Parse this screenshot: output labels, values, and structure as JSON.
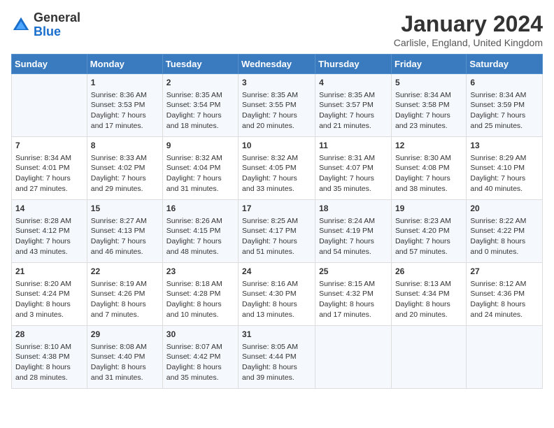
{
  "header": {
    "logo_line1": "General",
    "logo_line2": "Blue",
    "month": "January 2024",
    "location": "Carlisle, England, United Kingdom"
  },
  "days_of_week": [
    "Sunday",
    "Monday",
    "Tuesday",
    "Wednesday",
    "Thursday",
    "Friday",
    "Saturday"
  ],
  "weeks": [
    [
      {
        "day": "",
        "sunrise": "",
        "sunset": "",
        "daylight": ""
      },
      {
        "day": "1",
        "sunrise": "Sunrise: 8:36 AM",
        "sunset": "Sunset: 3:53 PM",
        "daylight": "Daylight: 7 hours and 17 minutes."
      },
      {
        "day": "2",
        "sunrise": "Sunrise: 8:35 AM",
        "sunset": "Sunset: 3:54 PM",
        "daylight": "Daylight: 7 hours and 18 minutes."
      },
      {
        "day": "3",
        "sunrise": "Sunrise: 8:35 AM",
        "sunset": "Sunset: 3:55 PM",
        "daylight": "Daylight: 7 hours and 20 minutes."
      },
      {
        "day": "4",
        "sunrise": "Sunrise: 8:35 AM",
        "sunset": "Sunset: 3:57 PM",
        "daylight": "Daylight: 7 hours and 21 minutes."
      },
      {
        "day": "5",
        "sunrise": "Sunrise: 8:34 AM",
        "sunset": "Sunset: 3:58 PM",
        "daylight": "Daylight: 7 hours and 23 minutes."
      },
      {
        "day": "6",
        "sunrise": "Sunrise: 8:34 AM",
        "sunset": "Sunset: 3:59 PM",
        "daylight": "Daylight: 7 hours and 25 minutes."
      }
    ],
    [
      {
        "day": "7",
        "sunrise": "Sunrise: 8:34 AM",
        "sunset": "Sunset: 4:01 PM",
        "daylight": "Daylight: 7 hours and 27 minutes."
      },
      {
        "day": "8",
        "sunrise": "Sunrise: 8:33 AM",
        "sunset": "Sunset: 4:02 PM",
        "daylight": "Daylight: 7 hours and 29 minutes."
      },
      {
        "day": "9",
        "sunrise": "Sunrise: 8:32 AM",
        "sunset": "Sunset: 4:04 PM",
        "daylight": "Daylight: 7 hours and 31 minutes."
      },
      {
        "day": "10",
        "sunrise": "Sunrise: 8:32 AM",
        "sunset": "Sunset: 4:05 PM",
        "daylight": "Daylight: 7 hours and 33 minutes."
      },
      {
        "day": "11",
        "sunrise": "Sunrise: 8:31 AM",
        "sunset": "Sunset: 4:07 PM",
        "daylight": "Daylight: 7 hours and 35 minutes."
      },
      {
        "day": "12",
        "sunrise": "Sunrise: 8:30 AM",
        "sunset": "Sunset: 4:08 PM",
        "daylight": "Daylight: 7 hours and 38 minutes."
      },
      {
        "day": "13",
        "sunrise": "Sunrise: 8:29 AM",
        "sunset": "Sunset: 4:10 PM",
        "daylight": "Daylight: 7 hours and 40 minutes."
      }
    ],
    [
      {
        "day": "14",
        "sunrise": "Sunrise: 8:28 AM",
        "sunset": "Sunset: 4:12 PM",
        "daylight": "Daylight: 7 hours and 43 minutes."
      },
      {
        "day": "15",
        "sunrise": "Sunrise: 8:27 AM",
        "sunset": "Sunset: 4:13 PM",
        "daylight": "Daylight: 7 hours and 46 minutes."
      },
      {
        "day": "16",
        "sunrise": "Sunrise: 8:26 AM",
        "sunset": "Sunset: 4:15 PM",
        "daylight": "Daylight: 7 hours and 48 minutes."
      },
      {
        "day": "17",
        "sunrise": "Sunrise: 8:25 AM",
        "sunset": "Sunset: 4:17 PM",
        "daylight": "Daylight: 7 hours and 51 minutes."
      },
      {
        "day": "18",
        "sunrise": "Sunrise: 8:24 AM",
        "sunset": "Sunset: 4:19 PM",
        "daylight": "Daylight: 7 hours and 54 minutes."
      },
      {
        "day": "19",
        "sunrise": "Sunrise: 8:23 AM",
        "sunset": "Sunset: 4:20 PM",
        "daylight": "Daylight: 7 hours and 57 minutes."
      },
      {
        "day": "20",
        "sunrise": "Sunrise: 8:22 AM",
        "sunset": "Sunset: 4:22 PM",
        "daylight": "Daylight: 8 hours and 0 minutes."
      }
    ],
    [
      {
        "day": "21",
        "sunrise": "Sunrise: 8:20 AM",
        "sunset": "Sunset: 4:24 PM",
        "daylight": "Daylight: 8 hours and 3 minutes."
      },
      {
        "day": "22",
        "sunrise": "Sunrise: 8:19 AM",
        "sunset": "Sunset: 4:26 PM",
        "daylight": "Daylight: 8 hours and 7 minutes."
      },
      {
        "day": "23",
        "sunrise": "Sunrise: 8:18 AM",
        "sunset": "Sunset: 4:28 PM",
        "daylight": "Daylight: 8 hours and 10 minutes."
      },
      {
        "day": "24",
        "sunrise": "Sunrise: 8:16 AM",
        "sunset": "Sunset: 4:30 PM",
        "daylight": "Daylight: 8 hours and 13 minutes."
      },
      {
        "day": "25",
        "sunrise": "Sunrise: 8:15 AM",
        "sunset": "Sunset: 4:32 PM",
        "daylight": "Daylight: 8 hours and 17 minutes."
      },
      {
        "day": "26",
        "sunrise": "Sunrise: 8:13 AM",
        "sunset": "Sunset: 4:34 PM",
        "daylight": "Daylight: 8 hours and 20 minutes."
      },
      {
        "day": "27",
        "sunrise": "Sunrise: 8:12 AM",
        "sunset": "Sunset: 4:36 PM",
        "daylight": "Daylight: 8 hours and 24 minutes."
      }
    ],
    [
      {
        "day": "28",
        "sunrise": "Sunrise: 8:10 AM",
        "sunset": "Sunset: 4:38 PM",
        "daylight": "Daylight: 8 hours and 28 minutes."
      },
      {
        "day": "29",
        "sunrise": "Sunrise: 8:08 AM",
        "sunset": "Sunset: 4:40 PM",
        "daylight": "Daylight: 8 hours and 31 minutes."
      },
      {
        "day": "30",
        "sunrise": "Sunrise: 8:07 AM",
        "sunset": "Sunset: 4:42 PM",
        "daylight": "Daylight: 8 hours and 35 minutes."
      },
      {
        "day": "31",
        "sunrise": "Sunrise: 8:05 AM",
        "sunset": "Sunset: 4:44 PM",
        "daylight": "Daylight: 8 hours and 39 minutes."
      },
      {
        "day": "",
        "sunrise": "",
        "sunset": "",
        "daylight": ""
      },
      {
        "day": "",
        "sunrise": "",
        "sunset": "",
        "daylight": ""
      },
      {
        "day": "",
        "sunrise": "",
        "sunset": "",
        "daylight": ""
      }
    ]
  ]
}
